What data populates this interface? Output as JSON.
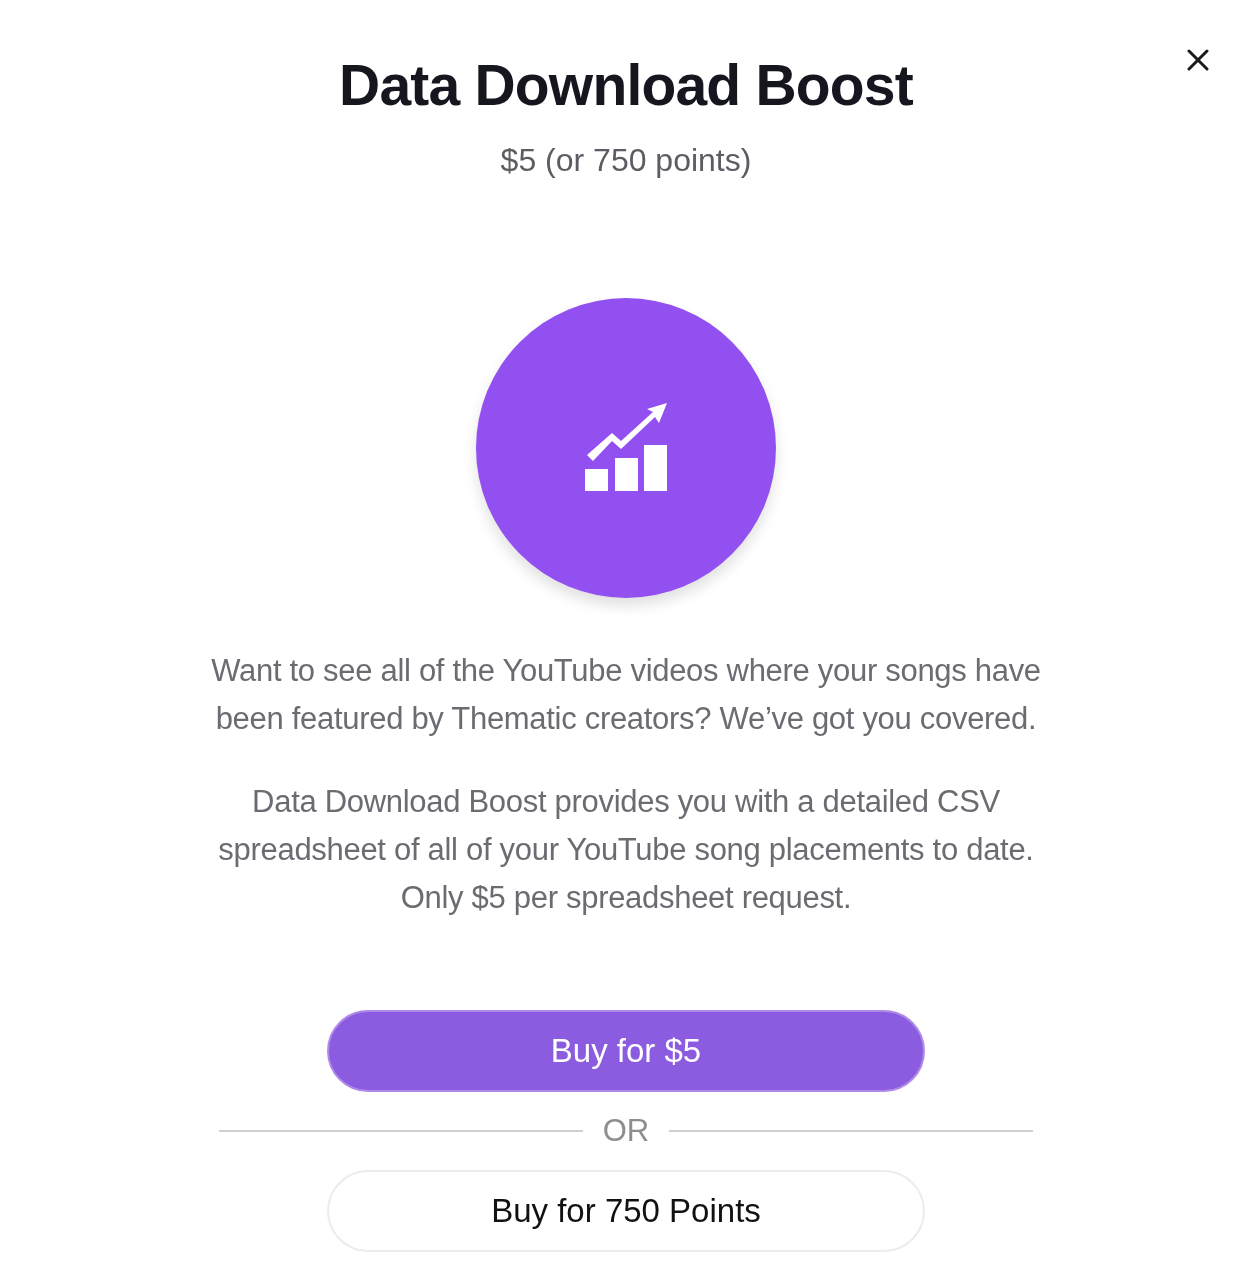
{
  "dialog": {
    "title": "Data Download Boost",
    "price": "$5 (or 750 points)"
  },
  "paragraphs": [
    "Want to see all of the YouTube videos where your songs have been featured by Thematic creators? We’ve got you covered.",
    "Data Download Boost provides you with a detailed CSV spreadsheet of all of your YouTube song placements to date. Only $5 per spreadsheet request."
  ],
  "buttons": [
    {
      "label": "Buy for $5",
      "kind": "primary"
    },
    {
      "label": "Buy for 750 Points",
      "kind": "secondary"
    }
  ],
  "separator": {
    "label": "OR"
  }
}
